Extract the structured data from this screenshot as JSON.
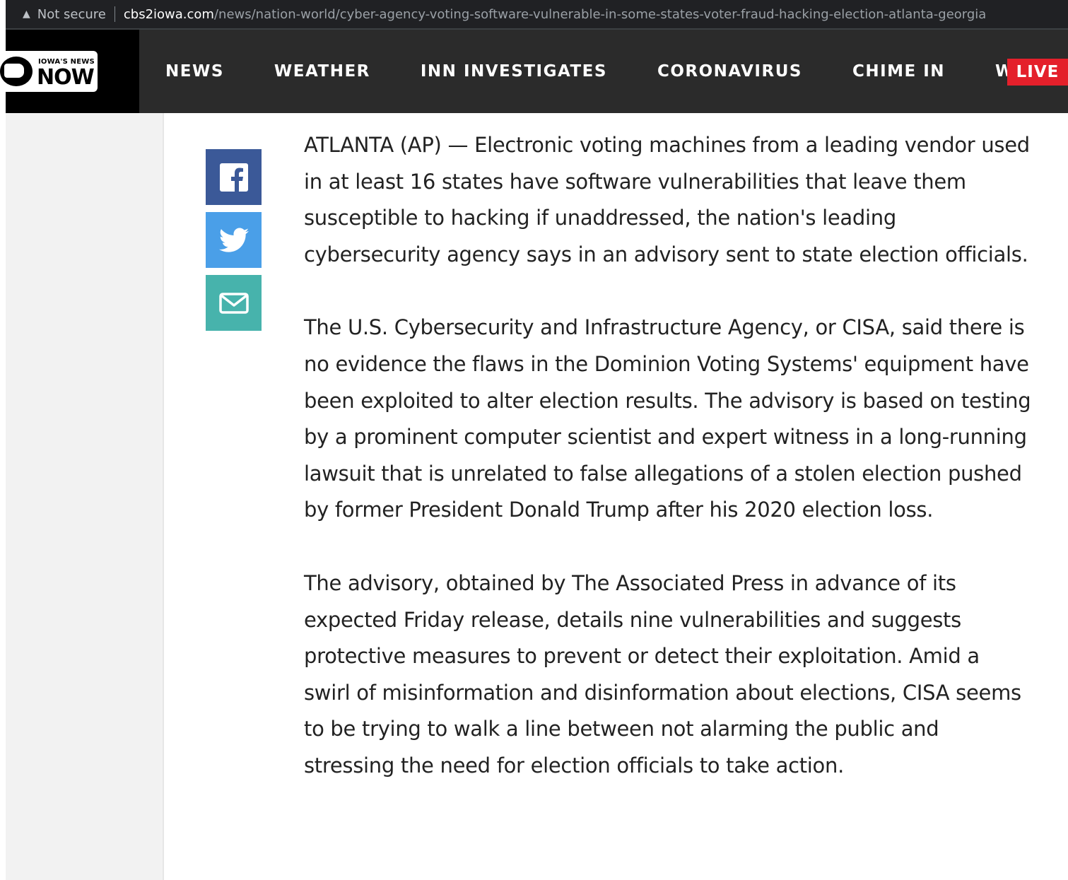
{
  "browser": {
    "security_label": "Not secure",
    "url_domain": "cbs2iowa.com",
    "url_path": "/news/nation-world/cyber-agency-voting-software-vulnerable-in-some-states-voter-fraud-hacking-election-atlanta-georgia"
  },
  "site": {
    "logo_tag": "IOWA'S NEWS",
    "logo_word": "NOW",
    "nav": [
      "NEWS",
      "WEATHER",
      "INN INVESTIGATES",
      "CORONAVIRUS",
      "CHIME IN",
      "WATCH"
    ],
    "live_label": "LIVE",
    "colors": {
      "header_bg": "#2b2b2b",
      "live_red": "#e4202b",
      "facebook": "#3b5998",
      "twitter": "#4a9fe8",
      "email": "#47b3ac"
    }
  },
  "share": {
    "icons": [
      "facebook-icon",
      "twitter-icon",
      "email-icon"
    ]
  },
  "article": {
    "paragraphs": [
      "ATLANTA (AP) — Electronic voting machines from a leading vendor used in at least 16 states have software vulnerabilities that leave them susceptible to hacking if unaddressed, the nation's leading cybersecurity agency says in an advisory sent to state election officials.",
      "The U.S. Cybersecurity and Infrastructure Agency, or CISA, said there is no evidence the flaws in the Dominion Voting Systems' equipment have been exploited to alter election results. The advisory is based on testing by a prominent computer scientist and expert witness in a long-running lawsuit that is unrelated to false allegations of a stolen election pushed by former President Donald Trump after his 2020 election loss.",
      "The advisory, obtained by The Associated Press in advance of its expected Friday release, details nine vulnerabilities and suggests protective measures to prevent or detect their exploitation. Amid a swirl of misinformation and disinformation about elections, CISA seems to be trying to walk a line between not alarming the public and stressing the need for election officials to take action."
    ]
  }
}
